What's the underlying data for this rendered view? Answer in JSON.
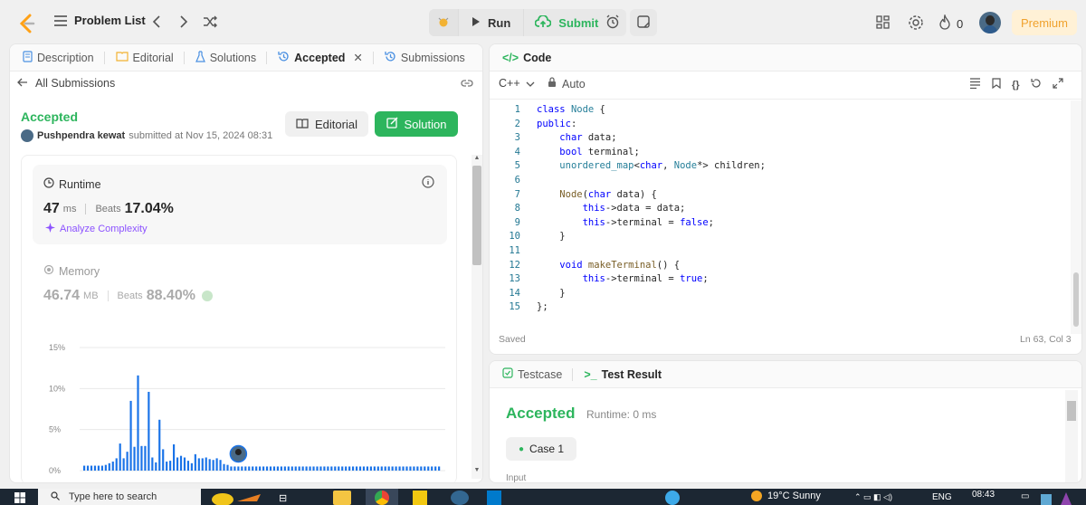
{
  "topbar": {
    "problem_list": "Problem List",
    "run": "Run",
    "submit": "Submit",
    "streak": "0",
    "premium": "Premium"
  },
  "left": {
    "tabs": [
      {
        "label": "Description",
        "icon": "description-icon"
      },
      {
        "label": "Editorial",
        "icon": "editorial-icon"
      },
      {
        "label": "Solutions",
        "icon": "flask-icon"
      },
      {
        "label": "Accepted",
        "icon": "history-icon",
        "active": true
      },
      {
        "label": "Submissions",
        "icon": "history-icon"
      }
    ],
    "all_submissions": "All Submissions",
    "status": "Accepted",
    "user": "Pushpendra kewat",
    "submitted_at": "submitted at Nov 15, 2024 08:31",
    "editorial_btn": "Editorial",
    "solution_btn": "Solution",
    "runtime": {
      "title": "Runtime",
      "value": "47",
      "unit": "ms",
      "beats_label": "Beats",
      "beats_value": "17.04%",
      "analyze": "Analyze Complexity"
    },
    "memory": {
      "title": "Memory",
      "value": "46.74",
      "unit": "MB",
      "beats_label": "Beats",
      "beats_value": "88.40%"
    },
    "chart_data": {
      "type": "bar",
      "ylabel": "",
      "yticks": [
        "15%",
        "10%",
        "5%",
        "0%"
      ],
      "ylim": [
        0,
        15
      ],
      "values": [
        0.6,
        0.6,
        0.6,
        0.6,
        0.6,
        0.6,
        0.7,
        0.9,
        1.1,
        1.5,
        3.3,
        1.5,
        2.3,
        8.5,
        2.9,
        11.6,
        3.0,
        3.0,
        9.6,
        1.6,
        1.0,
        6.2,
        2.6,
        1.1,
        1.2,
        3.2,
        1.6,
        1.8,
        1.6,
        1.2,
        0.9,
        2.0,
        1.5,
        1.5,
        1.6,
        1.4,
        1.3,
        1.5,
        1.3,
        0.8,
        0.7,
        0.5,
        0.5,
        0.5,
        0.5,
        0.5,
        0.5,
        0.5,
        0.5,
        0.5,
        0.5,
        0.5,
        0.5,
        0.5,
        0.5,
        0.5,
        0.5,
        0.5,
        0.5,
        0.5,
        0.5,
        0.5,
        0.5,
        0.5,
        0.5,
        0.5,
        0.5,
        0.5,
        0.5,
        0.5,
        0.5,
        0.5,
        0.5,
        0.5,
        0.5,
        0.5,
        0.5,
        0.5,
        0.5,
        0.5,
        0.5,
        0.5,
        0.5,
        0.5,
        0.5,
        0.5,
        0.5,
        0.5,
        0.5,
        0.5,
        0.5,
        0.5,
        0.5,
        0.5,
        0.5,
        0.5,
        0.5,
        0.5,
        0.5,
        0.5
      ],
      "marker_index": 43,
      "bar_color": "#1a73e8"
    }
  },
  "code": {
    "title": "Code",
    "language": "C++",
    "auto": "Auto",
    "lines": [
      "class Node {",
      "public:",
      "    char data;",
      "    bool terminal;",
      "    unordered_map<char, Node*> children;",
      "",
      "    Node(char data) {",
      "        this->data = data;",
      "        this->terminal = false;",
      "    }",
      "",
      "    void makeTerminal() {",
      "        this->terminal = true;",
      "    }",
      "};"
    ],
    "saved": "Saved",
    "cursor": "Ln 63, Col 3"
  },
  "result": {
    "testcase_tab": "Testcase",
    "result_tab": "Test Result",
    "status": "Accepted",
    "runtime": "Runtime: 0 ms",
    "case": "Case 1",
    "input_label": "Input"
  },
  "taskbar": {
    "search": "Type here to search",
    "weather": "19°C  Sunny",
    "lang": "ENG",
    "time": "08:43"
  },
  "colors": {
    "green": "#2db55d",
    "accent_blue": "#1a73e8",
    "premium_bg": "#fff1d6",
    "premium_fg": "#f0a22e"
  }
}
